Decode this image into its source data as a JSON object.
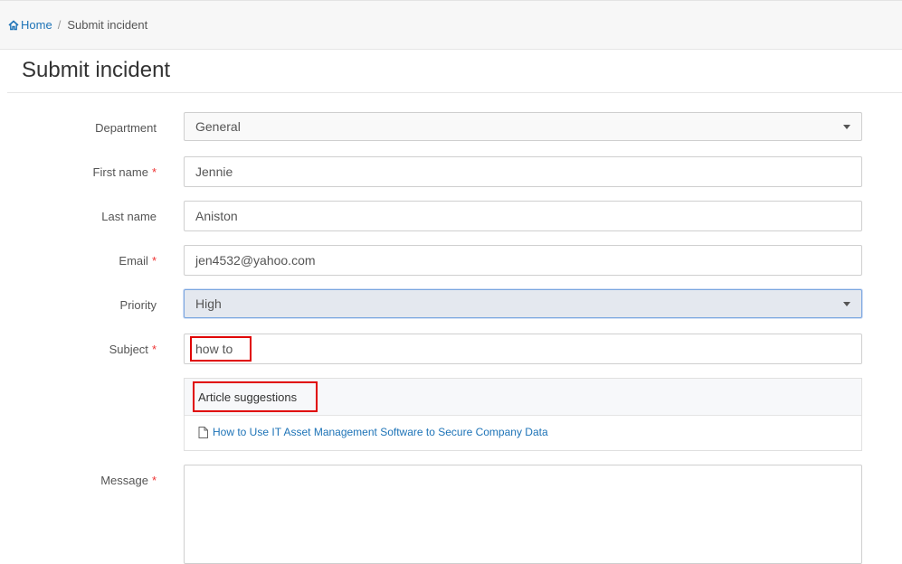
{
  "breadcrumb": {
    "home": "Home",
    "separator": "/",
    "current": "Submit incident"
  },
  "page": {
    "title": "Submit incident"
  },
  "form": {
    "department": {
      "label": "Department",
      "value": "General"
    },
    "first_name": {
      "label": "First name",
      "value": "Jennie",
      "required_mark": "*"
    },
    "last_name": {
      "label": "Last name",
      "value": "Aniston"
    },
    "email": {
      "label": "Email",
      "value": "jen4532@yahoo.com",
      "required_mark": "*"
    },
    "priority": {
      "label": "Priority",
      "value": "High"
    },
    "subject": {
      "label": "Subject",
      "value": "how to",
      "required_mark": "*"
    },
    "message": {
      "label": "Message",
      "value": "",
      "required_mark": "*"
    }
  },
  "suggestions": {
    "title": "Article suggestions",
    "articles": [
      {
        "title": "How to Use IT Asset Management Software to Secure Company Data"
      }
    ]
  },
  "colors": {
    "link": "#1d73b7",
    "required": "#ee3333",
    "highlight": "#e00000",
    "focus_border": "#7aa6e0"
  },
  "icons": {
    "home": "home-icon",
    "article": "document-icon",
    "dropdown": "caret-down-icon"
  }
}
